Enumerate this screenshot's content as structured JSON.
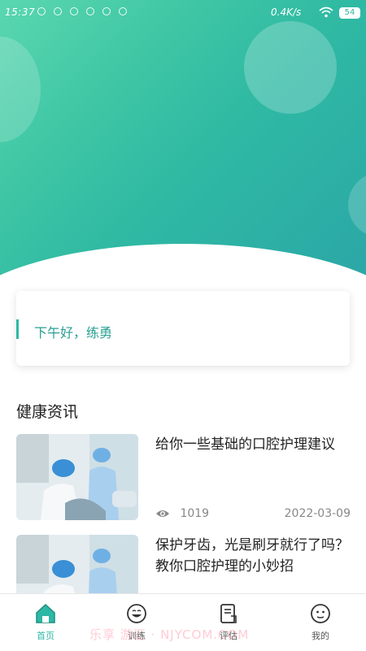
{
  "status_bar": {
    "time": "15:37",
    "network_speed": "0.4K/s",
    "battery": "54"
  },
  "greeting": {
    "text": "下午好，练勇"
  },
  "news_section": {
    "title": "健康资讯",
    "items": [
      {
        "title": "给你一些基础的口腔护理建议",
        "views": "1019",
        "date": "2022-03-09"
      },
      {
        "title": "保护牙齿，光是刷牙就行了吗？教你口腔护理的小妙招",
        "views": "",
        "date": ""
      }
    ]
  },
  "bottom_nav": {
    "tabs": [
      {
        "label": "首页",
        "icon": "home-icon",
        "active": true
      },
      {
        "label": "训练",
        "icon": "smile-face-icon",
        "active": false
      },
      {
        "label": "评估",
        "icon": "document-icon",
        "active": false
      },
      {
        "label": "我的",
        "icon": "face-icon",
        "active": false
      }
    ]
  },
  "watermark": "乐享 游汇 · NJYCOM.COM",
  "colors": {
    "accent": "#2db8a6",
    "gradient_start": "#5ad7b0",
    "gradient_end": "#2ba6a7"
  }
}
